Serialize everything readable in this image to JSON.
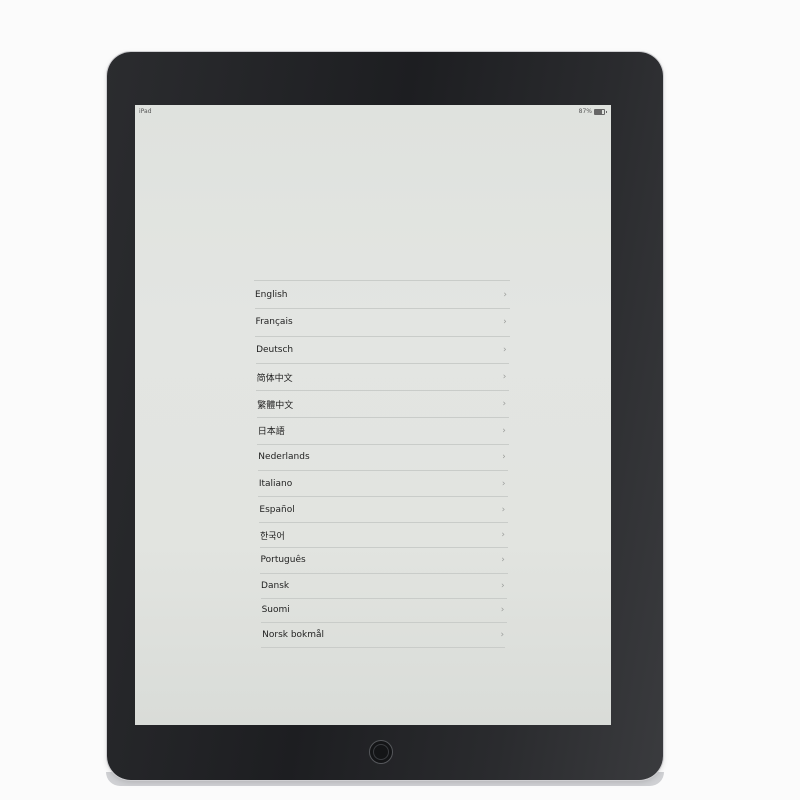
{
  "status_bar": {
    "device_label": "iPad",
    "battery_percent": "87%",
    "battery_icon": "battery-icon"
  },
  "language_list": {
    "chevron_glyph": "›",
    "items": [
      {
        "label": "English"
      },
      {
        "label": "Français"
      },
      {
        "label": "Deutsch"
      },
      {
        "label": "简体中文"
      },
      {
        "label": "繁體中文"
      },
      {
        "label": "日本語"
      },
      {
        "label": "Nederlands"
      },
      {
        "label": "Italiano"
      },
      {
        "label": "Español"
      },
      {
        "label": "한국어"
      },
      {
        "label": "Português"
      },
      {
        "label": "Dansk"
      },
      {
        "label": "Suomi"
      },
      {
        "label": "Norsk bokmål"
      }
    ]
  }
}
